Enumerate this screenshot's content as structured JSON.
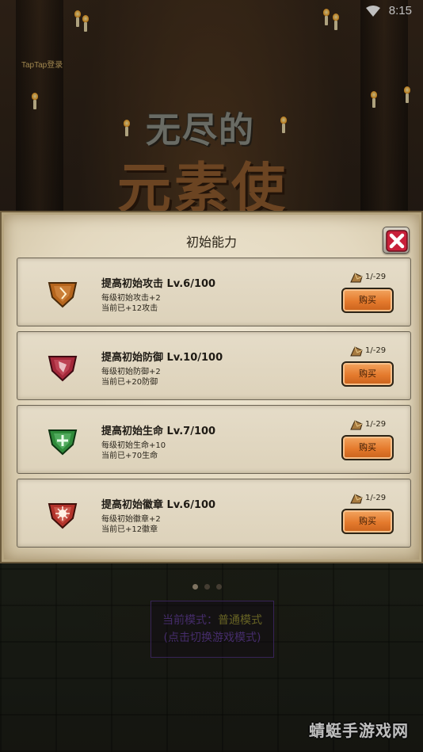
{
  "status_bar": {
    "time": "8:15"
  },
  "background": {
    "taptap_login": "TapTap登录",
    "logo": {
      "line1": "无尽的",
      "line2": "元素使"
    },
    "mode": {
      "label": "当前模式：",
      "value": "普通模式",
      "hint": "(点击切换游戏模式)"
    },
    "watermark": "蜻蜓手游戏网"
  },
  "dialog": {
    "title": "初始能力",
    "items": [
      {
        "title": "提高初始攻击 Lv.6/100",
        "line1": "每级初始攻击+2",
        "line2": "当前已+12攻击",
        "cost": "1/-29",
        "buy_label": "购买",
        "gem_color": "#b5651d"
      },
      {
        "title": "提高初始防御 Lv.10/100",
        "line1": "每级初始防御+2",
        "line2": "当前已+20防御",
        "cost": "1/-29",
        "buy_label": "购买",
        "gem_color": "#a3283a"
      },
      {
        "title": "提高初始生命 Lv.7/100",
        "line1": "每级初始生命+10",
        "line2": "当前已+70生命",
        "cost": "1/-29",
        "buy_label": "购买",
        "gem_color": "#2f8a3a"
      },
      {
        "title": "提高初始徽章 Lv.6/100",
        "line1": "每级初始徽章+2",
        "line2": "当前已+12徽章",
        "cost": "1/-29",
        "buy_label": "购买",
        "gem_color": "#b2332b"
      }
    ]
  },
  "colors": {
    "buy_button": "#e47a2d",
    "parchment": "#e3d8bf",
    "mode_text": "#5c3b8e",
    "mode_value": "#8a8530"
  }
}
